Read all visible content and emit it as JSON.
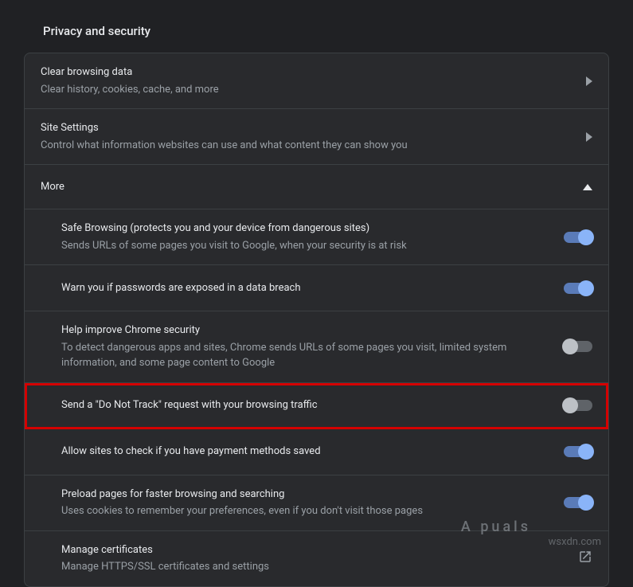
{
  "section_title": "Privacy and security",
  "rows": {
    "clear_data": {
      "title": "Clear browsing data",
      "desc": "Clear history, cookies, cache, and more"
    },
    "site_settings": {
      "title": "Site Settings",
      "desc": "Control what information websites can use and what content they can show you"
    },
    "more": {
      "title": "More"
    }
  },
  "more_items": {
    "safe_browsing": {
      "title": "Safe Browsing (protects you and your device from dangerous sites)",
      "desc": "Sends URLs of some pages you visit to Google, when your security is at risk",
      "toggle": true
    },
    "warn_passwords": {
      "title": "Warn you if passwords are exposed in a data breach",
      "toggle": true
    },
    "help_improve": {
      "title": "Help improve Chrome security",
      "desc": "To detect dangerous apps and sites, Chrome sends URLs of some pages you visit, limited system information, and some page content to Google",
      "toggle": false
    },
    "do_not_track": {
      "title": "Send a \"Do Not Track\" request with your browsing traffic",
      "toggle": false
    },
    "payment_check": {
      "title": "Allow sites to check if you have payment methods saved",
      "toggle": true
    },
    "preload": {
      "title": "Preload pages for faster browsing and searching",
      "desc": "Uses cookies to remember your preferences, even if you don't visit those pages",
      "toggle": true
    },
    "certificates": {
      "title": "Manage certificates",
      "desc": "Manage HTTPS/SSL certificates and settings"
    }
  },
  "watermark": "wsxdn.com",
  "logo": "A  puals"
}
